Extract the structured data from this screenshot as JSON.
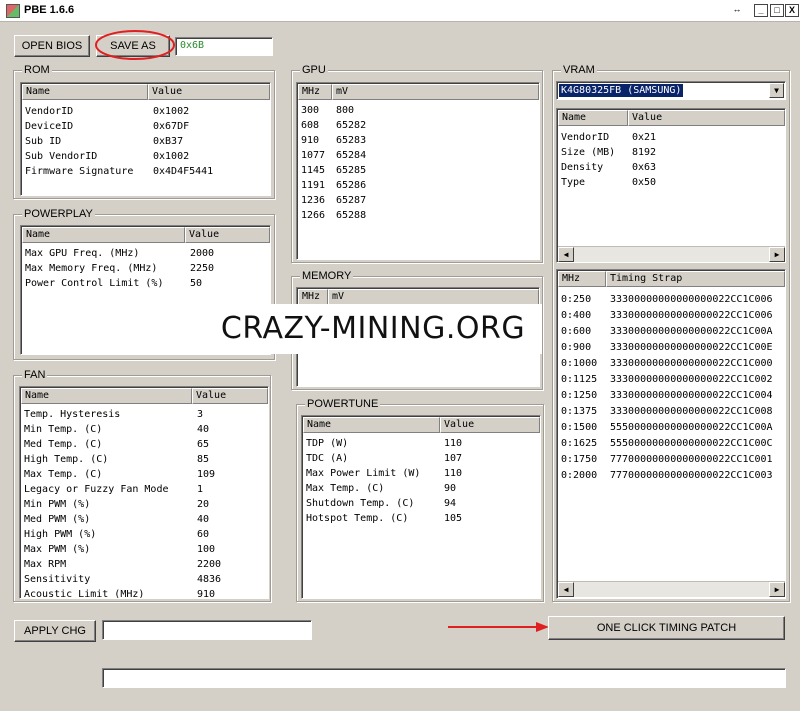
{
  "window": {
    "title": "PBE 1.6.6",
    "restore_glyph": "↔",
    "min_glyph": "_",
    "max_glyph": "□",
    "close_glyph": "X"
  },
  "toolbar": {
    "open_label": "OPEN BIOS",
    "save_label": "SAVE AS",
    "checksum_value": "0x6B"
  },
  "rom": {
    "label": "ROM",
    "col_name": "Name",
    "col_value": "Value",
    "rows": [
      {
        "name": "VendorID",
        "value": "0x1002"
      },
      {
        "name": "DeviceID",
        "value": "0x67DF"
      },
      {
        "name": "Sub ID",
        "value": "0xB37"
      },
      {
        "name": "Sub VendorID",
        "value": "0x1002"
      },
      {
        "name": "Firmware Signature",
        "value": "0x4D4F5441"
      }
    ]
  },
  "gpu": {
    "label": "GPU",
    "col_mhz": "MHz",
    "col_mv": "mV",
    "rows": [
      {
        "mhz": "300",
        "mv": "800"
      },
      {
        "mhz": "608",
        "mv": "65282"
      },
      {
        "mhz": "910",
        "mv": "65283"
      },
      {
        "mhz": "1077",
        "mv": "65284"
      },
      {
        "mhz": "1145",
        "mv": "65285"
      },
      {
        "mhz": "1191",
        "mv": "65286"
      },
      {
        "mhz": "1236",
        "mv": "65287"
      },
      {
        "mhz": "1266",
        "mv": "65288"
      }
    ]
  },
  "vram": {
    "label": "VRAM",
    "selected": "K4G80325FB (SAMSUNG)",
    "col_name": "Name",
    "col_value": "Value",
    "rows": [
      {
        "name": "VendorID",
        "value": "0x21"
      },
      {
        "name": "Size (MB)",
        "value": "8192"
      },
      {
        "name": "Density",
        "value": "0x63"
      },
      {
        "name": "Type",
        "value": "0x50"
      }
    ],
    "timing_col_mhz": "MHz",
    "timing_col_strap": "Timing Strap",
    "timings": [
      {
        "mhz": "0:250",
        "strap": "33300000000000000022CC1C006"
      },
      {
        "mhz": "0:400",
        "strap": "33300000000000000022CC1C006"
      },
      {
        "mhz": "0:600",
        "strap": "33300000000000000022CC1C00A"
      },
      {
        "mhz": "0:900",
        "strap": "33300000000000000022CC1C00E"
      },
      {
        "mhz": "0:1000",
        "strap": "33300000000000000022CC1C000"
      },
      {
        "mhz": "0:1125",
        "strap": "33300000000000000022CC1C002"
      },
      {
        "mhz": "0:1250",
        "strap": "33300000000000000022CC1C004"
      },
      {
        "mhz": "0:1375",
        "strap": "33300000000000000022CC1C008"
      },
      {
        "mhz": "0:1500",
        "strap": "55500000000000000022CC1C00A"
      },
      {
        "mhz": "0:1625",
        "strap": "55500000000000000022CC1C00C"
      },
      {
        "mhz": "0:1750",
        "strap": "77700000000000000022CC1C001"
      },
      {
        "mhz": "0:2000",
        "strap": "77700000000000000022CC1C003"
      }
    ]
  },
  "powerplay": {
    "label": "POWERPLAY",
    "col_name": "Name",
    "col_value": "Value",
    "rows": [
      {
        "name": "Max GPU Freq. (MHz)",
        "value": "2000"
      },
      {
        "name": "Max Memory Freq. (MHz)",
        "value": "2250"
      },
      {
        "name": "Power Control Limit (%)",
        "value": "50"
      }
    ]
  },
  "memory": {
    "label": "MEMORY",
    "col_mhz": "MHz",
    "col_mv": "mV"
  },
  "fan": {
    "label": "FAN",
    "col_name": "Name",
    "col_value": "Value",
    "rows": [
      {
        "name": "Temp. Hysteresis",
        "value": "3"
      },
      {
        "name": "Min Temp. (C)",
        "value": "40"
      },
      {
        "name": "Med Temp. (C)",
        "value": "65"
      },
      {
        "name": "High Temp. (C)",
        "value": "85"
      },
      {
        "name": "Max Temp. (C)",
        "value": "109"
      },
      {
        "name": "Legacy or Fuzzy Fan Mode",
        "value": "1"
      },
      {
        "name": "Min PWM (%)",
        "value": "20"
      },
      {
        "name": "Med PWM (%)",
        "value": "40"
      },
      {
        "name": "High PWM (%)",
        "value": "60"
      },
      {
        "name": "Max PWM (%)",
        "value": "100"
      },
      {
        "name": "Max RPM",
        "value": "2200"
      },
      {
        "name": "Sensitivity",
        "value": "4836"
      },
      {
        "name": "Acoustic Limit (MHz)",
        "value": "910"
      }
    ]
  },
  "powertune": {
    "label": "POWERTUNE",
    "col_name": "Name",
    "col_value": "Value",
    "rows": [
      {
        "name": "TDP (W)",
        "value": "110"
      },
      {
        "name": "TDC (A)",
        "value": "107"
      },
      {
        "name": "Max Power Limit (W)",
        "value": "110"
      },
      {
        "name": "Max Temp. (C)",
        "value": "90"
      },
      {
        "name": "Shutdown Temp. (C)",
        "value": "94"
      },
      {
        "name": "Hotspot Temp. (C)",
        "value": "105"
      }
    ]
  },
  "footer": {
    "apply_label": "APPLY CHG",
    "apply_value": "",
    "timing_patch_label": "ONE CLICK TIMING PATCH",
    "status_value": ""
  },
  "watermark": {
    "text": "CRAZY-MINING.ORG"
  },
  "colors": {
    "annotation_red": "#e02020",
    "selection_blue": "#0a246a",
    "checksum_green": "#2a8a2a"
  }
}
